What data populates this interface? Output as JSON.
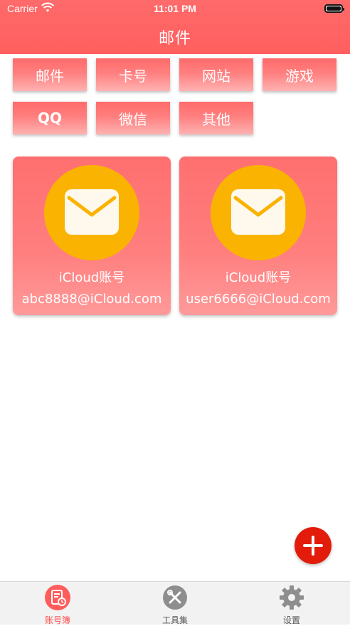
{
  "status": {
    "carrier": "Carrier",
    "time": "11:01 PM"
  },
  "header": {
    "title": "邮件"
  },
  "categories": [
    "邮件",
    "卡号",
    "网站",
    "游戏",
    "QQ",
    "微信",
    "其他"
  ],
  "cards": [
    {
      "name": "iCloud账号",
      "email": "abc8888@iCloud.com"
    },
    {
      "name": "iCloud账号",
      "email": "user6666@iCloud.com"
    }
  ],
  "tabs": [
    {
      "label": "账号簿",
      "icon": "account-book-icon",
      "active": true
    },
    {
      "label": "工具集",
      "icon": "tools-icon",
      "active": false
    },
    {
      "label": "设置",
      "icon": "settings-icon",
      "active": false
    }
  ],
  "colors": {
    "primary": "#ff6a6a",
    "accent_orange": "#f9b300",
    "fab": "#e31b0a",
    "tab_active": "#ff4e4e"
  }
}
